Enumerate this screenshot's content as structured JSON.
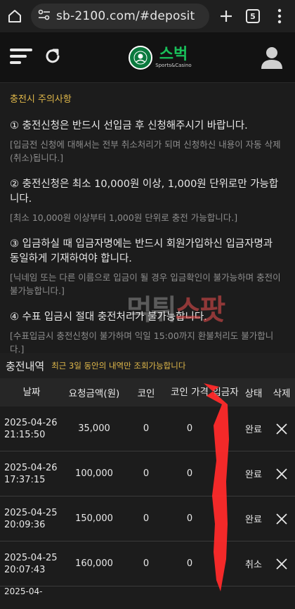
{
  "browser": {
    "url": "sb-2100.com/#deposit",
    "tab_count": "5"
  },
  "site": {
    "logo_text": "스벅",
    "logo_sub": "Sports&Casino"
  },
  "notice": {
    "title": "충전시 주의사항",
    "items": [
      {
        "main": "① 충전신청은 반드시 선입금 후 신청해주시기 바랍니다.",
        "sub": "[입금전 신청에 대해서는 전부 취소처리가 되며 신청하신 내용이 자동 삭제(취소)됩니다.]"
      },
      {
        "main": "② 충전신청은 최소 10,000원 이상, 1,000원 단위로만 가능합니다.",
        "sub": "[최소 10,000원 이상부터 1,000원 단위로 충전 가능합니다.]"
      },
      {
        "main": "③ 입금하실 때 입금자명에는 반드시 회원가입하신 입금자명과 동일하게 기재하여야 합니다.",
        "sub": "[닉네임 또는 다른 이름으로 입금이 될 경우 입금확인이 불가능하며 충전이 불가능합니다.]"
      },
      {
        "main": "④ 수표 입금시 절대 충전처리가 불가능합니다.",
        "sub": "[수표입금시 충전신청이 불가하며 익일 15:00까지 환불처리도 불가합니다.]"
      }
    ]
  },
  "watermark": {
    "part1": "먹튀",
    "part2": "스팟"
  },
  "history": {
    "title": "충전내역",
    "note": "최근 3일 동안의 내역만 조회가능합니다",
    "columns": {
      "date": "날짜",
      "amount": "요청금액(원)",
      "coin": "코인",
      "coin_price": "코인 가격",
      "depositor": "입금자",
      "status": "상태",
      "delete": "삭제"
    },
    "rows": [
      {
        "date": "2025-04-26 21:15:50",
        "amount": "35,000",
        "coin": "0",
        "price": "0",
        "status": "완료"
      },
      {
        "date": "2025-04-26 17:37:15",
        "amount": "100,000",
        "coin": "0",
        "price": "0",
        "status": "완료"
      },
      {
        "date": "2025-04-25 20:09:36",
        "amount": "150,000",
        "coin": "0",
        "price": "0",
        "status": "완료"
      },
      {
        "date": "2025-04-25 20:07:43",
        "amount": "160,000",
        "coin": "0",
        "price": "0",
        "status": "취소"
      }
    ],
    "partial_row_date": "2025-04-"
  },
  "colors": {
    "accent_gold": "#e0b84a",
    "brand_green": "#19c05a",
    "scribble_red": "#ff2a2a"
  }
}
